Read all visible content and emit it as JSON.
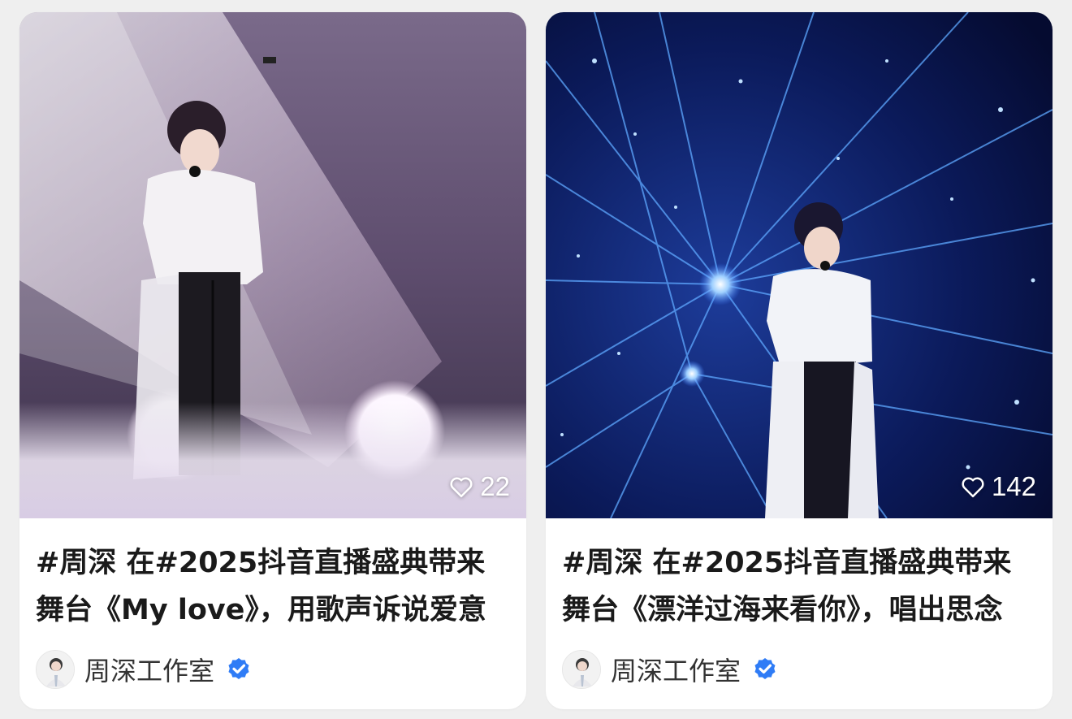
{
  "colors": {
    "verified_badge": "#2f7cf6",
    "card_bg": "#ffffff",
    "page_bg": "#efefef"
  },
  "cards": [
    {
      "image": "performer in white jacket singing on misty stage with pink spotlight",
      "likes": "22",
      "title": "#周深 在#2025抖音直播盛典带来舞台《My love》，用歌声诉说爱意",
      "author": "周深工作室",
      "like_icon": "heart-outline-icon",
      "badge_icon": "verified-badge-icon"
    },
    {
      "image": "performer in white jacket singing under blue laser light burst",
      "likes": "142",
      "title": "#周深 在#2025抖音直播盛典带来舞台《漂洋过海来看你》，唱出思念",
      "author": "周深工作室",
      "like_icon": "heart-outline-icon",
      "badge_icon": "verified-badge-icon"
    }
  ]
}
